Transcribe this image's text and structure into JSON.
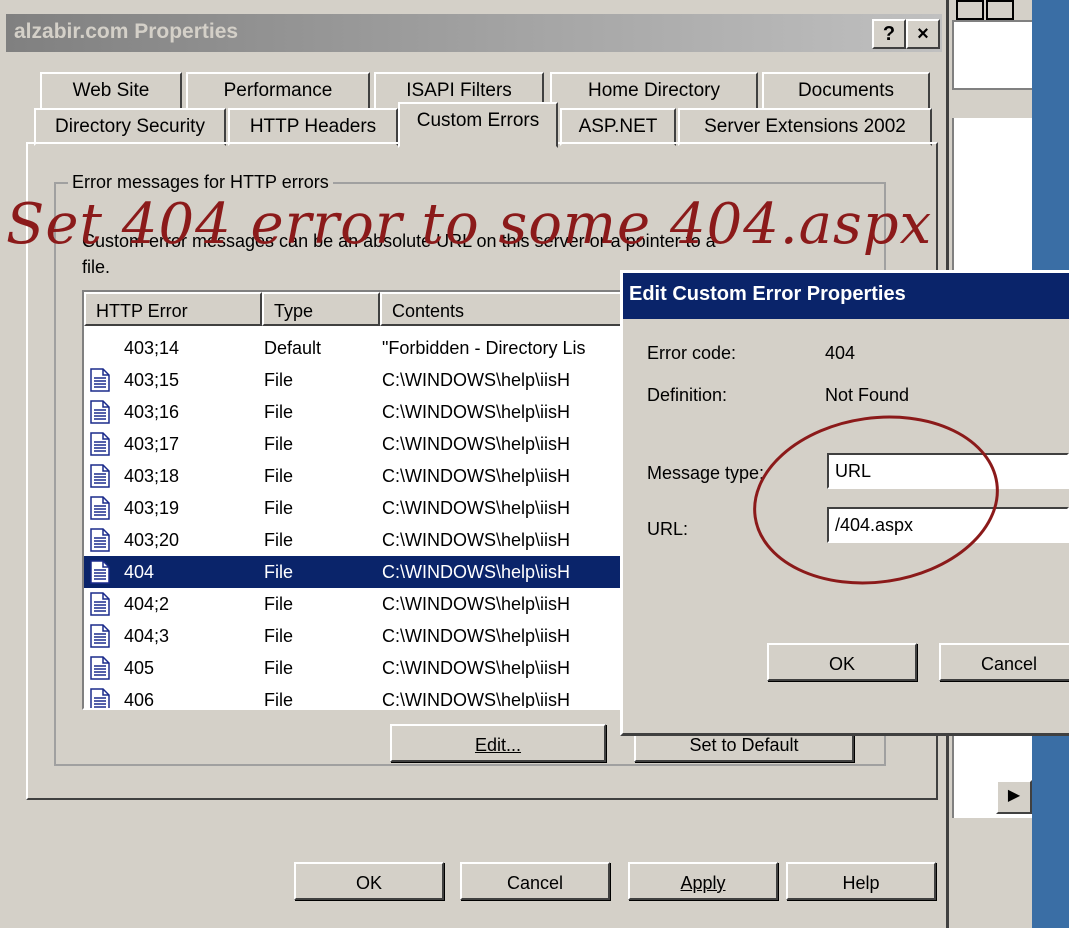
{
  "window": {
    "title": "alzabir.com Properties",
    "help_btn": "?",
    "close_btn": "×"
  },
  "tabs_row1": [
    "Web Site",
    "Performance",
    "ISAPI Filters",
    "Home Directory",
    "Documents"
  ],
  "tabs_row2": [
    "Directory Security",
    "HTTP Headers",
    "Custom Errors",
    "ASP.NET",
    "Server Extensions 2002"
  ],
  "active_tab": "Custom Errors",
  "group": {
    "label": "Error messages for HTTP errors",
    "description_line1": "Custom error messages can be an absolute URL on this server or a pointer to a",
    "description_line2": "file."
  },
  "list": {
    "headers": [
      "HTTP Error",
      "Type",
      "Contents"
    ],
    "rows": [
      {
        "error": "403;14",
        "type": "Default",
        "contents": "\"Forbidden - Directory Lis",
        "icon": false
      },
      {
        "error": "403;15",
        "type": "File",
        "contents": "C:\\WINDOWS\\help\\iisH",
        "icon": true
      },
      {
        "error": "403;16",
        "type": "File",
        "contents": "C:\\WINDOWS\\help\\iisH",
        "icon": true
      },
      {
        "error": "403;17",
        "type": "File",
        "contents": "C:\\WINDOWS\\help\\iisH",
        "icon": true
      },
      {
        "error": "403;18",
        "type": "File",
        "contents": "C:\\WINDOWS\\help\\iisH",
        "icon": true
      },
      {
        "error": "403;19",
        "type": "File",
        "contents": "C:\\WINDOWS\\help\\iisH",
        "icon": true
      },
      {
        "error": "403;20",
        "type": "File",
        "contents": "C:\\WINDOWS\\help\\iisH",
        "icon": true
      },
      {
        "error": "404",
        "type": "File",
        "contents": "C:\\WINDOWS\\help\\iisH",
        "icon": true,
        "selected": true
      },
      {
        "error": "404;2",
        "type": "File",
        "contents": "C:\\WINDOWS\\help\\iisH",
        "icon": true
      },
      {
        "error": "404;3",
        "type": "File",
        "contents": "C:\\WINDOWS\\help\\iisH",
        "icon": true
      },
      {
        "error": "405",
        "type": "File",
        "contents": "C:\\WINDOWS\\help\\iisH",
        "icon": true
      },
      {
        "error": "406",
        "type": "File",
        "contents": "C:\\WINDOWS\\help\\iisH",
        "icon": true
      }
    ]
  },
  "panel_buttons": {
    "edit": "Edit...",
    "set_default": "Set to Default"
  },
  "footer_buttons": {
    "ok": "OK",
    "cancel": "Cancel",
    "apply": "Apply",
    "help": "Help"
  },
  "edit_dialog": {
    "title": "Edit Custom Error Properties",
    "error_code_label": "Error code:",
    "error_code_value": "404",
    "definition_label": "Definition:",
    "definition_value": "Not Found",
    "message_type_label": "Message type:",
    "message_type_value": "URL",
    "url_label": "URL:",
    "url_value": "/404.aspx",
    "ok": "OK",
    "cancel": "Cancel"
  },
  "annotation": {
    "text": "Set 404 error to some 404.aspx",
    "color": "#8b1a1a"
  },
  "background": {
    "scroll_arrow": "▶"
  },
  "colors": {
    "face": "#d4d0c8",
    "selection": "#0a246a",
    "desktop": "#3a6ea5"
  }
}
